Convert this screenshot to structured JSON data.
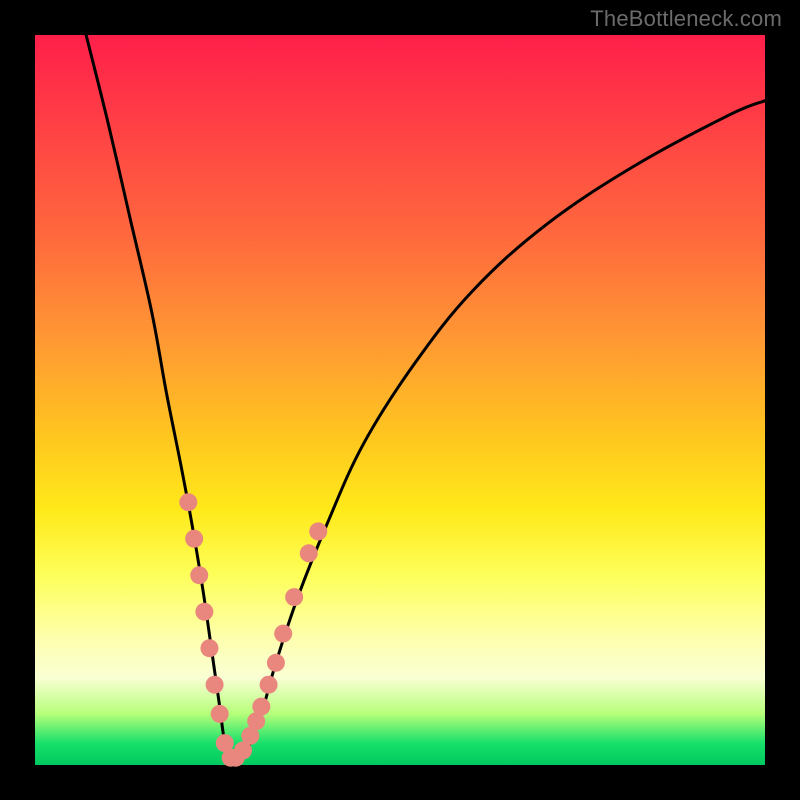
{
  "watermark": "TheBottleneck.com",
  "chart_data": {
    "type": "line",
    "title": "",
    "xlabel": "",
    "ylabel": "",
    "xlim": [
      0,
      100
    ],
    "ylim": [
      0,
      100
    ],
    "series": [
      {
        "name": "bottleneck-curve",
        "x": [
          7,
          10,
          13,
          16,
          18,
          20,
          21.5,
          23,
          24.3,
          25.3,
          26,
          26.8,
          27.5,
          29,
          31,
          33,
          36,
          40,
          45,
          52,
          60,
          70,
          82,
          95,
          100
        ],
        "values": [
          100,
          88,
          75,
          62,
          51,
          41,
          33,
          24,
          15,
          8,
          3,
          0.5,
          0.5,
          2,
          7,
          14,
          23,
          33,
          44,
          55,
          65,
          74,
          82,
          89,
          91
        ]
      }
    ],
    "markers": {
      "name": "highlight-dots",
      "color": "#e9877f",
      "points": [
        {
          "x": 21.0,
          "y": 36
        },
        {
          "x": 21.8,
          "y": 31
        },
        {
          "x": 22.5,
          "y": 26
        },
        {
          "x": 23.2,
          "y": 21
        },
        {
          "x": 23.9,
          "y": 16
        },
        {
          "x": 24.6,
          "y": 11
        },
        {
          "x": 25.3,
          "y": 7
        },
        {
          "x": 26.0,
          "y": 3
        },
        {
          "x": 26.8,
          "y": 1
        },
        {
          "x": 27.5,
          "y": 1
        },
        {
          "x": 28.5,
          "y": 2
        },
        {
          "x": 29.5,
          "y": 4
        },
        {
          "x": 30.3,
          "y": 6
        },
        {
          "x": 31.0,
          "y": 8
        },
        {
          "x": 32.0,
          "y": 11
        },
        {
          "x": 33.0,
          "y": 14
        },
        {
          "x": 34.0,
          "y": 18
        },
        {
          "x": 35.5,
          "y": 23
        },
        {
          "x": 37.5,
          "y": 29
        },
        {
          "x": 38.8,
          "y": 32
        }
      ]
    }
  }
}
